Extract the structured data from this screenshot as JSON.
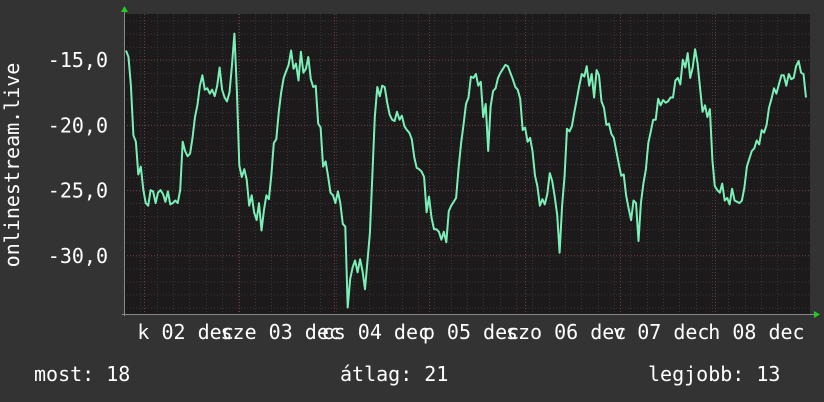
{
  "colors": {
    "background": "#333333",
    "plot_background": "#1c1a1a",
    "grid_minor": "#3a3434",
    "grid_major": "#6a3e3e",
    "line": "#7af0b8",
    "axis_arrow": "#22cc22",
    "text": "#ffffff"
  },
  "chart_data": {
    "type": "line",
    "ylabel": "onlinestream.live",
    "ylim": [
      -34.5,
      -11.5
    ],
    "y_ticks": [
      -15,
      -20,
      -25,
      -30
    ],
    "y_tick_labels": [
      "-15,0",
      "-20,0",
      "-25,0",
      "-30,0"
    ],
    "x_tick_labels": [
      "k 02 dec",
      "sze 03 dec",
      "cs 04 dec",
      "p 05 dec",
      "szo 06 dec",
      "v 07 dec",
      "h 08 dec"
    ],
    "grid": true,
    "series": [
      {
        "values": [
          -14.3,
          -14.8,
          -17.0,
          -20.8,
          -21.3,
          -23.8,
          -23.2,
          -24.9,
          -26.0,
          -26.2,
          -25.0,
          -25.1,
          -26.0,
          -25.2,
          -25.0,
          -25.3,
          -25.9,
          -25.1,
          -26.1,
          -26.0,
          -25.8,
          -26.0,
          -25.0,
          -21.3,
          -22.0,
          -22.4,
          -22.2,
          -21.0,
          -19.4,
          -18.5,
          -17.0,
          -16.2,
          -17.3,
          -17.2,
          -17.6,
          -17.3,
          -17.8,
          -17.0,
          -15.6,
          -17.3,
          -17.9,
          -18.2,
          -17.5,
          -15.5,
          -13.0,
          -17.4,
          -23.1,
          -24.0,
          -23.4,
          -24.2,
          -26.2,
          -25.4,
          -26.7,
          -27.3,
          -26.0,
          -28.1,
          -26.5,
          -25.4,
          -25.7,
          -23.8,
          -21.4,
          -21.1,
          -19.0,
          -17.5,
          -16.4,
          -15.9,
          -15.4,
          -14.3,
          -15.7,
          -15.3,
          -16.6,
          -14.4,
          -16.0,
          -15.7,
          -14.8,
          -16.5,
          -17.1,
          -17.0,
          -19.9,
          -20.2,
          -23.2,
          -22.8,
          -23.9,
          -25.2,
          -25.4,
          -26.0,
          -25.1,
          -26.0,
          -27.6,
          -27.8,
          -34.0,
          -31.8,
          -30.9,
          -30.4,
          -31.3,
          -30.3,
          -31.2,
          -32.6,
          -30.5,
          -28.3,
          -23.8,
          -19.4,
          -17.1,
          -17.8,
          -17.0,
          -17.1,
          -18.3,
          -19.2,
          -19.6,
          -19.7,
          -19.0,
          -19.6,
          -19.3,
          -20.1,
          -20.4,
          -20.6,
          -21.1,
          -22.5,
          -23.3,
          -23.4,
          -23.6,
          -24.0,
          -26.7,
          -25.5,
          -27.1,
          -28.0,
          -28.0,
          -28.2,
          -28.8,
          -28.2,
          -29.0,
          -26.6,
          -26.2,
          -25.9,
          -25.6,
          -23.3,
          -21.4,
          -20.0,
          -18.4,
          -17.9,
          -16.3,
          -16.4,
          -16.1,
          -17.0,
          -16.7,
          -19.4,
          -18.4,
          -22.0,
          -18.6,
          -17.4,
          -17.2,
          -16.4,
          -16.0,
          -15.7,
          -15.4,
          -15.5,
          -16.0,
          -16.5,
          -17.1,
          -17.3,
          -18.0,
          -20.4,
          -20.2,
          -21.3,
          -21.0,
          -22.0,
          -23.9,
          -24.7,
          -26.2,
          -25.7,
          -26.1,
          -25.3,
          -23.7,
          -24.3,
          -25.5,
          -26.9,
          -29.8,
          -26.2,
          -23.9,
          -20.3,
          -20.5,
          -20.1,
          -19.0,
          -18.0,
          -17.0,
          -16.1,
          -16.3,
          -15.5,
          -17.0,
          -16.1,
          -17.9,
          -15.8,
          -16.2,
          -18.2,
          -18.7,
          -20.0,
          -19.9,
          -20.7,
          -21.0,
          -22.0,
          -23.0,
          -23.9,
          -23.8,
          -25.4,
          -26.4,
          -27.3,
          -25.8,
          -26.0,
          -28.9,
          -26.0,
          -24.5,
          -23.4,
          -21.4,
          -20.5,
          -19.6,
          -19.6,
          -18.0,
          -18.5,
          -18.1,
          -18.3,
          -18.2,
          -17.9,
          -17.9,
          -16.6,
          -16.4,
          -16.9,
          -15.0,
          -15.6,
          -14.5,
          -16.4,
          -15.6,
          -14.2,
          -15.3,
          -17.2,
          -19.0,
          -18.5,
          -19.4,
          -18.8,
          -22.7,
          -24.7,
          -25.0,
          -25.2,
          -24.5,
          -25.8,
          -25.6,
          -26.1,
          -24.9,
          -25.8,
          -25.9,
          -26.0,
          -25.8,
          -24.8,
          -23.2,
          -22.6,
          -22.0,
          -21.8,
          -21.2,
          -21.5,
          -20.4,
          -20.6,
          -20.0,
          -18.7,
          -18.0,
          -17.2,
          -17.6,
          -16.9,
          -16.2,
          -16.2,
          -17.0,
          -16.1,
          -16.5,
          -16.4,
          -15.5,
          -15.1,
          -16.0,
          -16.1,
          -17.9
        ]
      }
    ]
  },
  "stats": {
    "current": "most: 18",
    "average": "átlag: 21",
    "best": "legjobb: 13"
  }
}
